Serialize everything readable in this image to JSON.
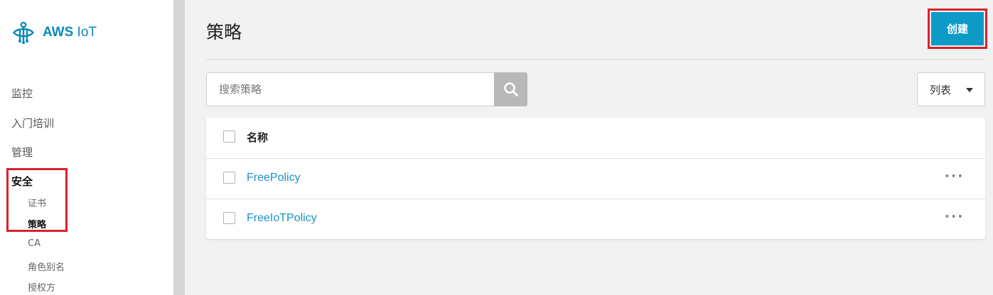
{
  "app": {
    "brand_strong": "AWS",
    "brand_rest": " IoT"
  },
  "sidebar": {
    "items": [
      {
        "label": "监控"
      },
      {
        "label": "入门培训"
      },
      {
        "label": "管理"
      }
    ],
    "section": {
      "label": "安全",
      "items": [
        {
          "label": "证书"
        },
        {
          "label": "策略",
          "active": true
        },
        {
          "label": "CA"
        },
        {
          "label": "角色别名"
        },
        {
          "label": "授权方"
        }
      ]
    }
  },
  "page": {
    "title": "策略",
    "create_label": "创建"
  },
  "search": {
    "placeholder": "搜索策略",
    "icon": "search-icon"
  },
  "view_select": {
    "value": "列表",
    "icon": "caret-down-icon"
  },
  "table": {
    "header": "名称",
    "rows": [
      {
        "name": "FreePolicy",
        "actions": "•••"
      },
      {
        "name": "FreeIoTPolicy",
        "actions": "•••"
      }
    ]
  },
  "colors": {
    "brand": "#0d8ab8",
    "primary_button": "#0c9bc7",
    "link": "#1492c4",
    "highlight_box": "#d8232a",
    "search_button": "#b8b8b8"
  }
}
